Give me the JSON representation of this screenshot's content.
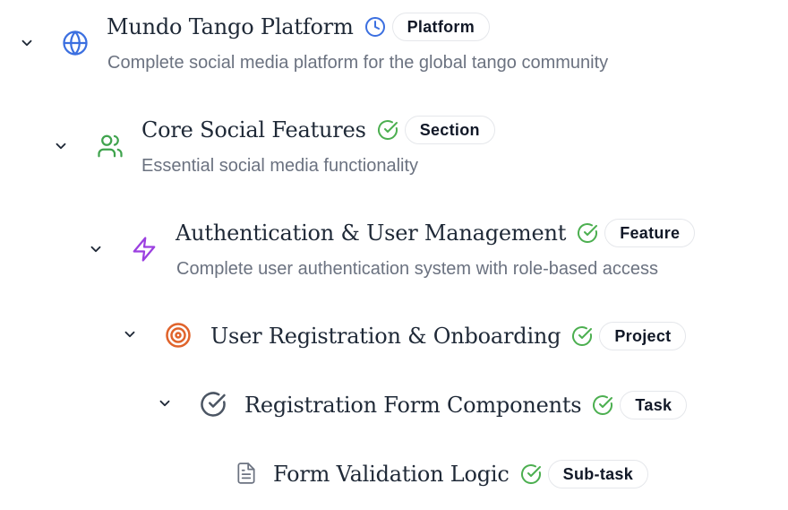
{
  "items": [
    {
      "title": "Mundo Tango Platform",
      "badge": "Platform",
      "description": "Complete social media platform for the global tango community",
      "icon": "globe-icon",
      "status": "clock-icon",
      "expanded": true
    },
    {
      "title": "Core Social Features",
      "badge": "Section",
      "description": "Essential social media functionality",
      "icon": "users-icon",
      "status": "check-circle-icon",
      "expanded": true
    },
    {
      "title": "Authentication & User Management",
      "badge": "Feature",
      "description": "Complete user authentication system with role-based access",
      "icon": "zap-icon",
      "status": "check-circle-icon",
      "expanded": true
    },
    {
      "title": "User Registration & Onboarding",
      "badge": "Project",
      "description": "",
      "icon": "target-icon",
      "status": "check-circle-icon",
      "expanded": true
    },
    {
      "title": "Registration Form Components",
      "badge": "Task",
      "description": "",
      "icon": "check-circle-icon",
      "status": "check-circle-icon",
      "expanded": true
    },
    {
      "title": "Form Validation Logic",
      "badge": "Sub-task",
      "description": "",
      "icon": "file-text-icon",
      "status": "check-circle-icon",
      "expanded": false
    }
  ],
  "colors": {
    "globe": "#3b6fe0",
    "users": "#3fa34d",
    "zap": "#9b3fe0",
    "target": "#e0632b",
    "check": "#4b5563",
    "file": "#6b7280",
    "status_done": "#4caf50",
    "status_pending": "#3b6fe0"
  }
}
